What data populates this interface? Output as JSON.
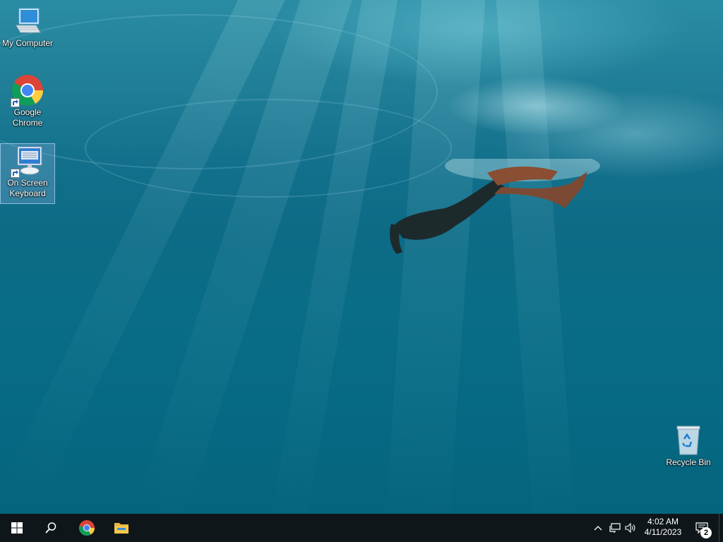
{
  "desktop": {
    "icons": [
      {
        "label": "My Computer",
        "icon": "computer-icon"
      },
      {
        "label": "Google Chrome",
        "icon": "chrome-icon"
      },
      {
        "label": "On Screen Keyboard",
        "icon": "keyboard-icon",
        "selected": true
      },
      {
        "label": "Recycle Bin",
        "icon": "recycle-bin-icon"
      }
    ]
  },
  "taskbar": {
    "start": "start-button",
    "pinned": [
      "search-icon",
      "chrome-icon",
      "file-explorer-icon"
    ],
    "tray": [
      "show-hidden-icons",
      "network-icon",
      "volume-icon"
    ],
    "clock": {
      "time": "4:02 AM",
      "date": "4/11/2023"
    },
    "notifications": {
      "count": "2"
    }
  },
  "colors": {
    "taskbar": "#0f1619",
    "wallpaper_top": "#2a8ca3",
    "wallpaper_bottom": "#05647d",
    "selection": "#78aad2"
  }
}
